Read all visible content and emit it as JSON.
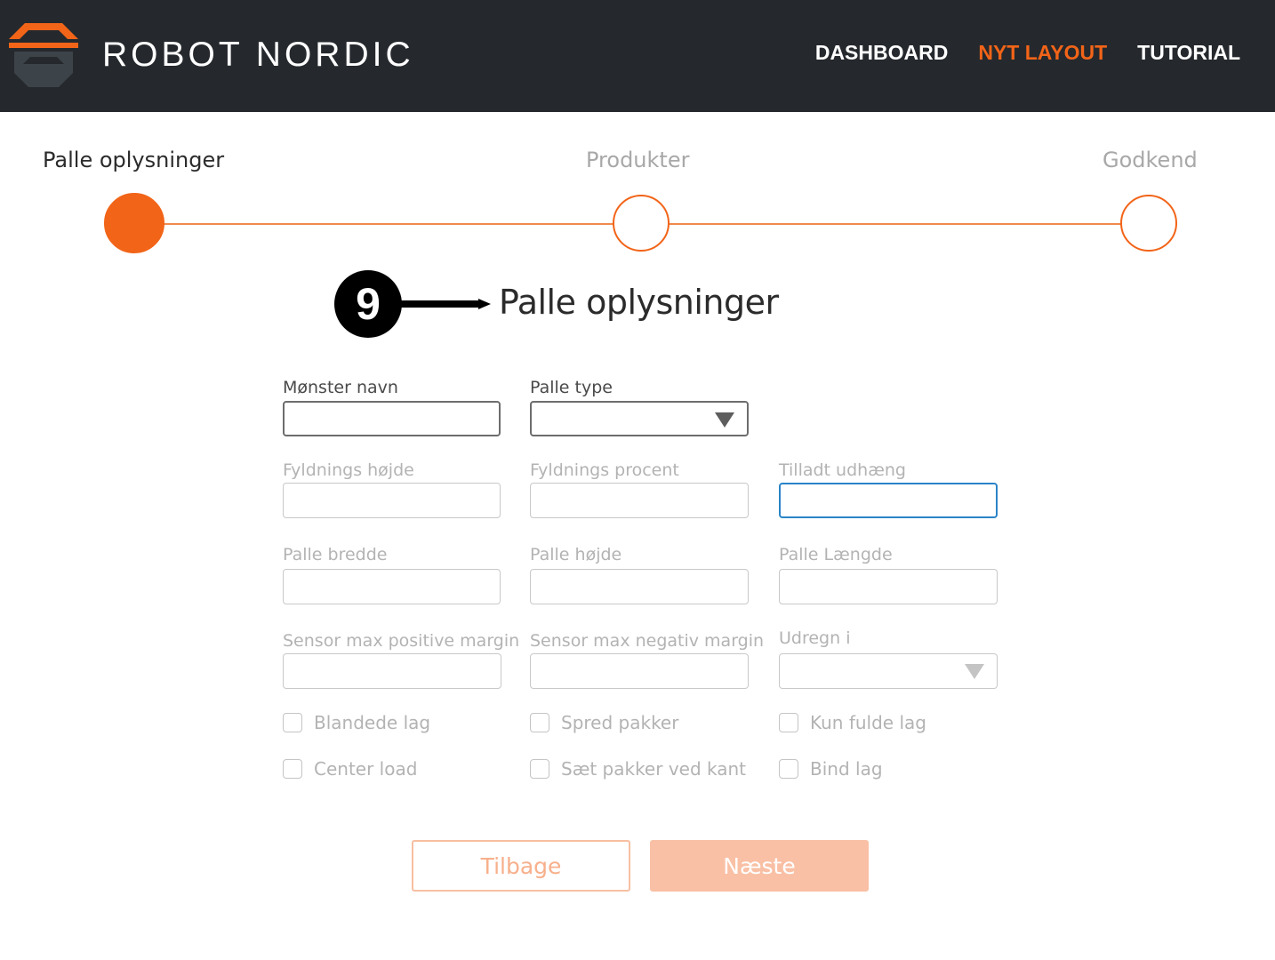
{
  "brand": {
    "name": "ROBOT NORDIC"
  },
  "nav": [
    {
      "label": "DASHBOARD",
      "active": false
    },
    {
      "label": "NYT LAYOUT",
      "active": true
    },
    {
      "label": "TUTORIAL",
      "active": false
    }
  ],
  "steps": [
    {
      "label": "Palle oplysninger",
      "state": "active"
    },
    {
      "label": "Produkter",
      "state": "inactive"
    },
    {
      "label": "Godkend",
      "state": "inactive"
    }
  ],
  "annotation": {
    "number": "9"
  },
  "page": {
    "title": "Palle oplysninger"
  },
  "form": {
    "pattern_name": {
      "label": "Mønster navn",
      "value": ""
    },
    "pallet_type": {
      "label": "Palle type",
      "value": ""
    },
    "fill_height": {
      "label": "Fyldnings højde",
      "value": ""
    },
    "fill_percent": {
      "label": "Fyldnings procent",
      "value": ""
    },
    "allowed_overhang": {
      "label": "Tilladt udhæng",
      "value": ""
    },
    "pallet_width": {
      "label": "Palle bredde",
      "value": ""
    },
    "pallet_height": {
      "label": "Palle højde",
      "value": ""
    },
    "pallet_length": {
      "label": "Palle Længde",
      "value": ""
    },
    "sensor_pos": {
      "label": "Sensor max positive margin",
      "value": ""
    },
    "sensor_neg": {
      "label": "Sensor max negativ margin",
      "value": ""
    },
    "calc_in": {
      "label": "Udregn i",
      "value": ""
    }
  },
  "checkboxes": {
    "mixed_layers": "Blandede lag",
    "spread_packages": "Spred pakker",
    "full_layers_only": "Kun fulde lag",
    "center_load": "Center load",
    "packages_at_edge": "Sæt pakker ved kant",
    "bind_layers": "Bind lag"
  },
  "buttons": {
    "back": "Tilbage",
    "next": "Næste"
  },
  "colors": {
    "accent": "#f26418",
    "header_bg": "#25292d",
    "focus": "#2a84c8"
  }
}
